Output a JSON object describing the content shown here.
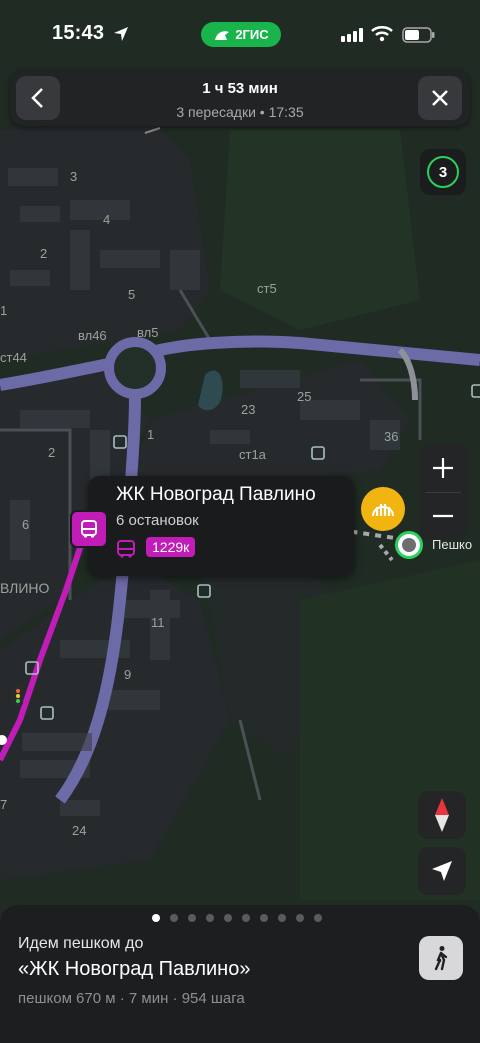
{
  "status_bar": {
    "time": "15:43",
    "brand": "2ГИС"
  },
  "route_header": {
    "duration": "1 ч 53 мин",
    "details": "3 пересадки • 17:35"
  },
  "layers_counter": "3",
  "popup": {
    "title": "ЖК Новоград Павлино",
    "stops": "6 остановок",
    "route_number": "1229к"
  },
  "destination_label": "Пешко",
  "map_labels": [
    "3",
    "4",
    "2",
    "5",
    "1",
    "вл46",
    "вл5",
    "ст5",
    "ст44",
    "23",
    "25",
    "ст1а",
    "36",
    "1",
    "2",
    "6",
    "11",
    "9",
    "7",
    "24",
    "ВЛИНО"
  ],
  "bottom_sheet": {
    "line1": "Идем пешком до",
    "line2": "«ЖК Новоград Павлино»",
    "line3": "пешком 670 м · 7 мин · 954 шага",
    "pager_total": 10,
    "pager_active": 0
  },
  "colors": {
    "route_bus": "#c21cb8",
    "main_road": "#6d6aa8",
    "brand": "#19b44b",
    "metro": "#f2b410",
    "pin_ring": "#2bd15c"
  },
  "icons": [
    "back-chevron-icon",
    "close-icon",
    "plus-icon",
    "minus-icon",
    "compass-icon",
    "navigation-arrow-icon",
    "walking-person-icon",
    "bus-icon",
    "metro-icon",
    "wifi-icon",
    "signal-icon",
    "battery-icon",
    "location-arrow-icon"
  ]
}
